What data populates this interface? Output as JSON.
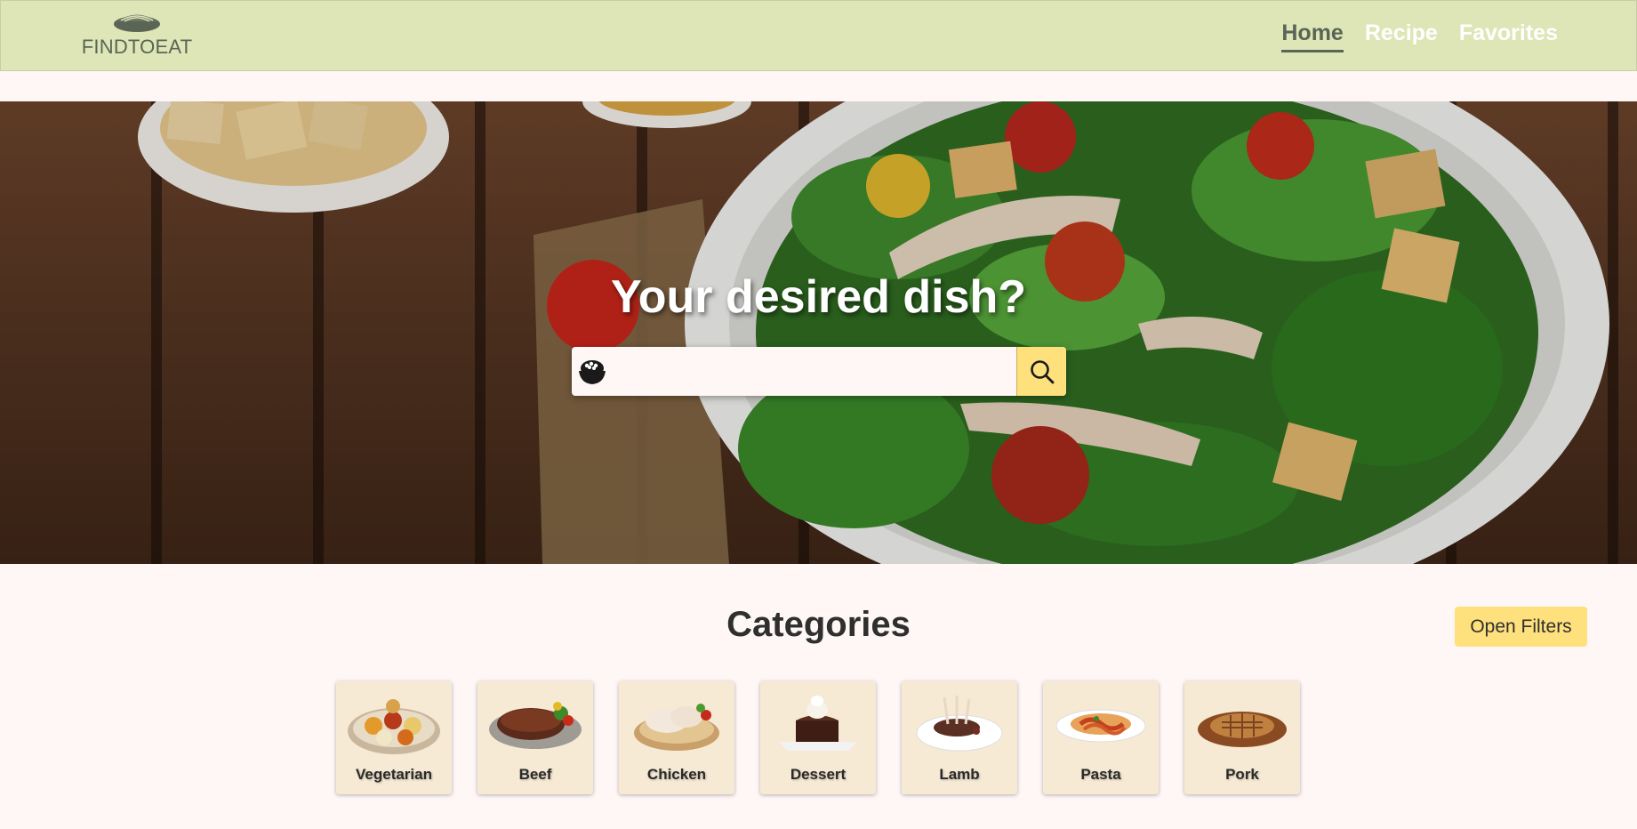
{
  "header": {
    "brand": "FINDTOEAT",
    "nav": [
      {
        "label": "Home",
        "active": true
      },
      {
        "label": "Recipe",
        "active": false
      },
      {
        "label": "Favorites",
        "active": false
      }
    ]
  },
  "hero": {
    "title": "Your desired dish?",
    "search": {
      "value": "",
      "placeholder": "",
      "icon": "rice-bowl-icon",
      "button_icon": "search-icon"
    }
  },
  "categories": {
    "title": "Categories",
    "filters_button": "Open Filters",
    "items": [
      {
        "label": "Vegetarian",
        "icon": "vegetarian-platter-image"
      },
      {
        "label": "Beef",
        "icon": "beef-steak-image"
      },
      {
        "label": "Chicken",
        "icon": "chicken-image"
      },
      {
        "label": "Dessert",
        "icon": "dessert-cake-image"
      },
      {
        "label": "Lamb",
        "icon": "lamb-chops-image"
      },
      {
        "label": "Pasta",
        "icon": "pasta-image"
      },
      {
        "label": "Pork",
        "icon": "pork-chop-image"
      }
    ]
  },
  "colors": {
    "header_bg": "#dee5b6",
    "brand_text": "#5a6556",
    "accent_yellow": "#fee07d",
    "page_bg": "#fff7f6",
    "card_bg": "#f6ead4"
  }
}
